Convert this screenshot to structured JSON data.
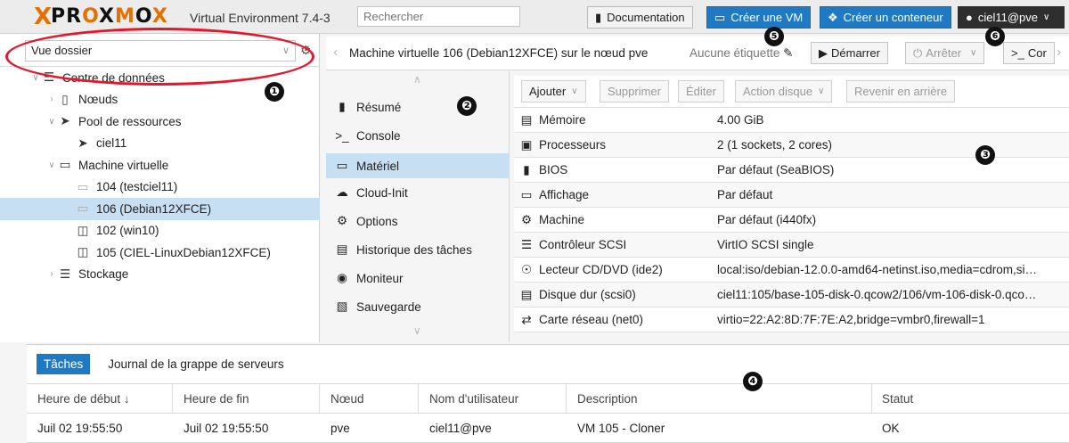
{
  "app": {
    "name": "PROXMOX",
    "subtitle": "Virtual Environment 7.4-3"
  },
  "top": {
    "search_placeholder": "Rechercher",
    "doc_label": "Documentation",
    "create_vm_label": "Créer une VM",
    "create_ct_label": "Créer un conteneur",
    "user_label": "ciel11@pve"
  },
  "left": {
    "view_selector": "Vue dossier",
    "tree": [
      {
        "label": "Centre de données",
        "icon": "datacenter-icon"
      },
      {
        "label": "Nœuds",
        "icon": "nodes-icon"
      },
      {
        "label": "Pool de ressources",
        "icon": "tags-icon"
      },
      {
        "label": "ciel11",
        "icon": "tag-icon"
      },
      {
        "label": "Machine virtuelle",
        "icon": "monitor-icon"
      },
      {
        "label": "104 (testciel11)",
        "icon": "vm-icon"
      },
      {
        "label": "106 (Debian12XFCE)",
        "icon": "vm-icon"
      },
      {
        "label": "102 (win10)",
        "icon": "template-icon"
      },
      {
        "label": "105 (CIEL-LinuxDebian12XFCE)",
        "icon": "template-icon"
      },
      {
        "label": "Stockage",
        "icon": "storage-icon"
      }
    ]
  },
  "vm_header": {
    "title": "Machine virtuelle 106 (Debian12XFCE) sur le nœud pve",
    "tag": "Aucune étiquette",
    "start": "Démarrer",
    "stop": "Arrêter",
    "console": "Cor"
  },
  "nav": [
    {
      "label": "Résumé",
      "icon": "book-icon"
    },
    {
      "label": "Console",
      "icon": "terminal-icon"
    },
    {
      "label": "Matériel",
      "icon": "desktop-icon"
    },
    {
      "label": "Cloud-Init",
      "icon": "cloud-icon"
    },
    {
      "label": "Options",
      "icon": "gear-icon"
    },
    {
      "label": "Historique des tâches",
      "icon": "list-icon"
    },
    {
      "label": "Moniteur",
      "icon": "eye-icon"
    },
    {
      "label": "Sauvegarde",
      "icon": "floppy-icon"
    }
  ],
  "hw_toolbar": {
    "add": "Ajouter",
    "remove": "Supprimer",
    "edit": "Éditer",
    "disk_action": "Action disque",
    "revert": "Revenir en arrière"
  },
  "hardware": [
    {
      "name": "Mémoire",
      "value": "4.00 GiB",
      "icon": "memory-icon"
    },
    {
      "name": "Processeurs",
      "value": "2 (1 sockets, 2 cores)",
      "icon": "cpu-icon"
    },
    {
      "name": "BIOS",
      "value": "Par défaut (SeaBIOS)",
      "icon": "bios-icon"
    },
    {
      "name": "Affichage",
      "value": "Par défaut",
      "icon": "display-icon"
    },
    {
      "name": "Machine",
      "value": "Par défaut (i440fx)",
      "icon": "cogs-icon"
    },
    {
      "name": "Contrôleur SCSI",
      "value": "VirtIO SCSI single",
      "icon": "database-icon"
    },
    {
      "name": "Lecteur CD/DVD (ide2)",
      "value": "local:iso/debian-12.0.0-amd64-netinst.iso,media=cdrom,si…",
      "icon": "cdrom-icon"
    },
    {
      "name": "Disque dur (scsi0)",
      "value": "ciel11:105/base-105-disk-0.qcow2/106/vm-106-disk-0.qco…",
      "icon": "harddisk-icon"
    },
    {
      "name": "Carte réseau (net0)",
      "value": "virtio=22:A2:8D:7F:7E:A2,bridge=vmbr0,firewall=1",
      "icon": "network-icon"
    }
  ],
  "bottom": {
    "tab_tasks": "Tâches",
    "tab_log": "Journal de la grappe de serveurs",
    "columns": [
      "Heure de début ↓",
      "Heure de fin",
      "Nœud",
      "Nom d'utilisateur",
      "Description",
      "Statut"
    ],
    "rows": [
      [
        "Juil 02 19:55:50",
        "Juil 02 19:55:50",
        "pve",
        "ciel11@pve",
        "VM 105 - Cloner",
        "OK"
      ]
    ]
  },
  "callouts": [
    "❶",
    "❷",
    "❸",
    "❹",
    "❺",
    "❻"
  ],
  "colors": {
    "accent": "#1f7ac3",
    "selection": "#c7dff3",
    "logo_orange": "#e57000",
    "annotation_red": "#e4182d"
  }
}
